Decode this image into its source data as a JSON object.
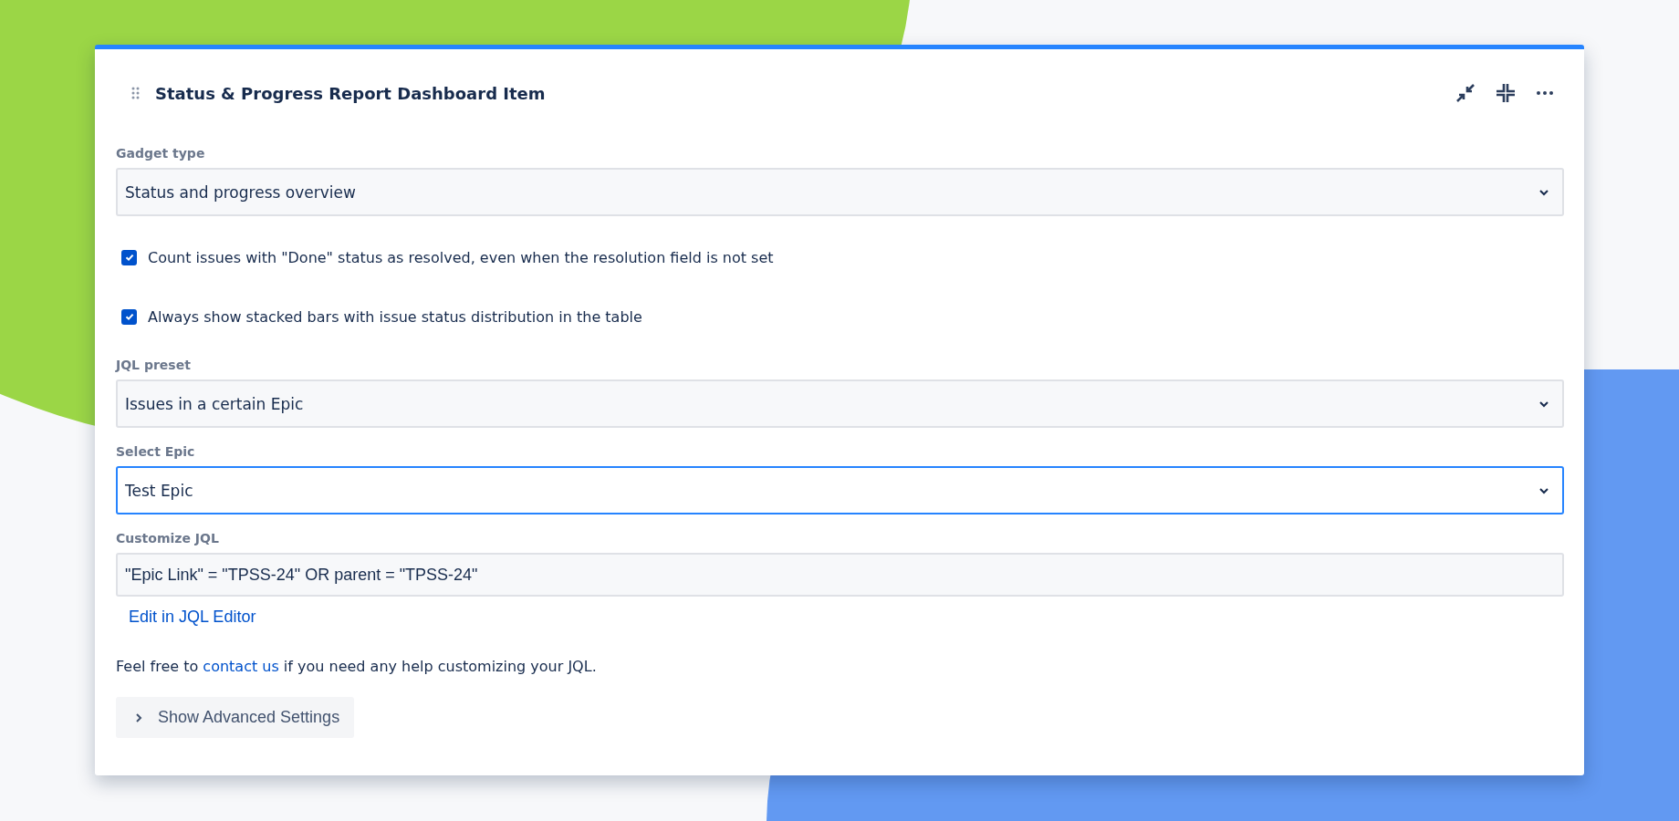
{
  "card": {
    "title": "Status & Progress Report Dashboard Item"
  },
  "form": [
    {
      "kind": "select",
      "label": "Gadget type",
      "value": "Status and progress overview",
      "focused": false
    },
    {
      "kind": "checkbox",
      "label": "Count issues with \"Done\" status as resolved, even when the resolution field is not set",
      "checked": true
    },
    {
      "kind": "checkbox",
      "label": "Always show stacked bars with issue status distribution in the table",
      "checked": true
    },
    {
      "kind": "select",
      "label": "JQL preset",
      "value": "Issues in a certain Epic",
      "focused": false
    },
    {
      "kind": "select",
      "label": "Select Epic",
      "value": "Test Epic",
      "focused": true
    },
    {
      "kind": "text",
      "label": "Customize JQL",
      "value": "\"Epic Link\" = \"TPSS-24\" OR parent = \"TPSS-24\"",
      "focused": false,
      "link": "Edit in JQL Editor"
    }
  ],
  "help": {
    "before": "Feel free to",
    "link": "contact us",
    "after": "if you need any help customizing your JQL."
  },
  "advanced_button": {
    "label": "Show Advanced Settings",
    "expanded": false
  }
}
